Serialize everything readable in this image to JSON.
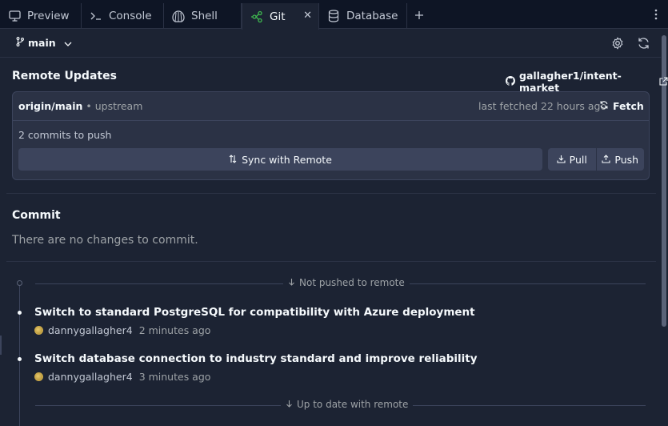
{
  "tabs": [
    {
      "label": "Preview",
      "icon": "monitor-icon"
    },
    {
      "label": "Console",
      "icon": "terminal-icon"
    },
    {
      "label": "Shell",
      "icon": "shell-icon"
    },
    {
      "label": "Git",
      "icon": "git-icon",
      "active": true
    },
    {
      "label": "Database",
      "icon": "database-icon"
    }
  ],
  "toolbar": {
    "branch": "main"
  },
  "remote": {
    "title": "Remote Updates",
    "repo": "gallagher1/intent-market",
    "origin": "origin/main",
    "upstream": "upstream",
    "last_fetched": "last fetched 22 hours ago",
    "fetch_label": "Fetch",
    "commits_to_push": "2 commits to push",
    "sync_label": "Sync with Remote",
    "pull_label": "Pull",
    "push_label": "Push"
  },
  "commit": {
    "title": "Commit",
    "empty_message": "There are no changes to commit."
  },
  "history": {
    "not_pushed_label": "Not pushed to remote",
    "up_to_date_label": "Up to date with remote",
    "commits": [
      {
        "message": "Switch to standard PostgreSQL for compatibility with Azure deployment",
        "author": "dannygallagher4",
        "time": "2 minutes ago"
      },
      {
        "message": "Switch database connection to industry standard and improve reliability",
        "author": "dannygallagher4",
        "time": "3 minutes ago"
      }
    ]
  },
  "colors": {
    "background": "#1c2333",
    "tabbar": "#0e1525",
    "card": "#2b3245",
    "button": "#3c445c",
    "git_accent": "#3fb950"
  }
}
